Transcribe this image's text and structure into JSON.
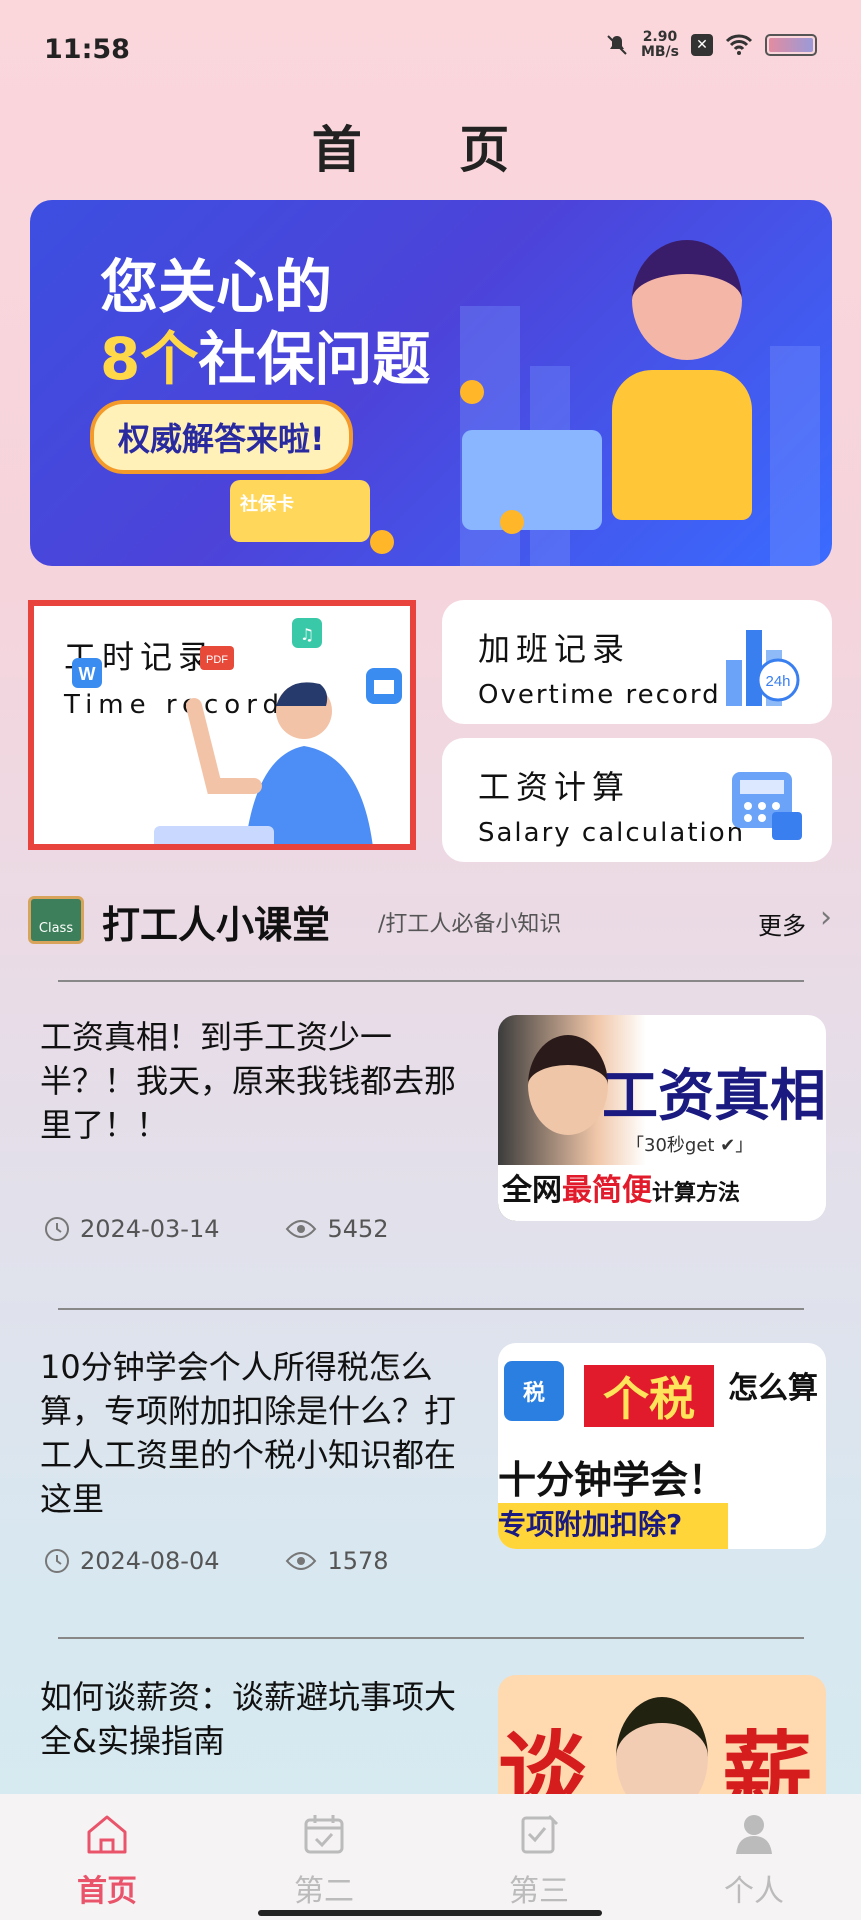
{
  "status_bar": {
    "time": "11:58",
    "speed_value": "2.90",
    "speed_unit": "MB/s"
  },
  "page": {
    "title": "首 页"
  },
  "banner": {
    "line1": "您关心的",
    "line2_num": "8个",
    "line2_rest": "社保问题",
    "pill": "权威解答来啦!",
    "card_text": "社保卡"
  },
  "tiles": {
    "time_record": {
      "title": "工时记录",
      "subtitle": "Time record"
    },
    "overtime_record": {
      "title": "加班记录",
      "subtitle": "Overtime record",
      "badge": "24h"
    },
    "salary_calc": {
      "title": "工资计算",
      "subtitle": "Salary calculation"
    }
  },
  "section": {
    "icon_text": "Class",
    "title": "打工人小课堂",
    "subtitle": "/打工人必备小知识",
    "more": "更多"
  },
  "articles": [
    {
      "title": "工资真相！到手工资少一半？！我天，原来我钱都去那里了！！",
      "date": "2024-03-14",
      "views": "5452",
      "thumb": {
        "big": "工资真相",
        "tag": "「30秒get ✔」",
        "bar_a": "全网",
        "bar_b": "最简便",
        "bar_c": "计算方法"
      }
    },
    {
      "title": "10分钟学会个人所得税怎么算，专项附加扣除是什么？打工人工资里的个税小知识都在这里",
      "date": "2024-08-04",
      "views": "1578",
      "thumb": {
        "shield": "税",
        "red": "个税",
        "how": "怎么算",
        "mid": "十分钟学会！",
        "btm": "专项附加扣除?"
      }
    },
    {
      "title": "如何谈薪资：谈薪避坑事项大全&实操指南",
      "thumb": {
        "left": "谈",
        "right": "薪"
      }
    }
  ],
  "tabbar": [
    {
      "label": "首页"
    },
    {
      "label": "第二"
    },
    {
      "label": "第三"
    },
    {
      "label": "个人"
    }
  ],
  "colors": {
    "accent": "#e9546b",
    "highlight_border": "#e8433d",
    "banner_bg": "#3c4fe0"
  }
}
